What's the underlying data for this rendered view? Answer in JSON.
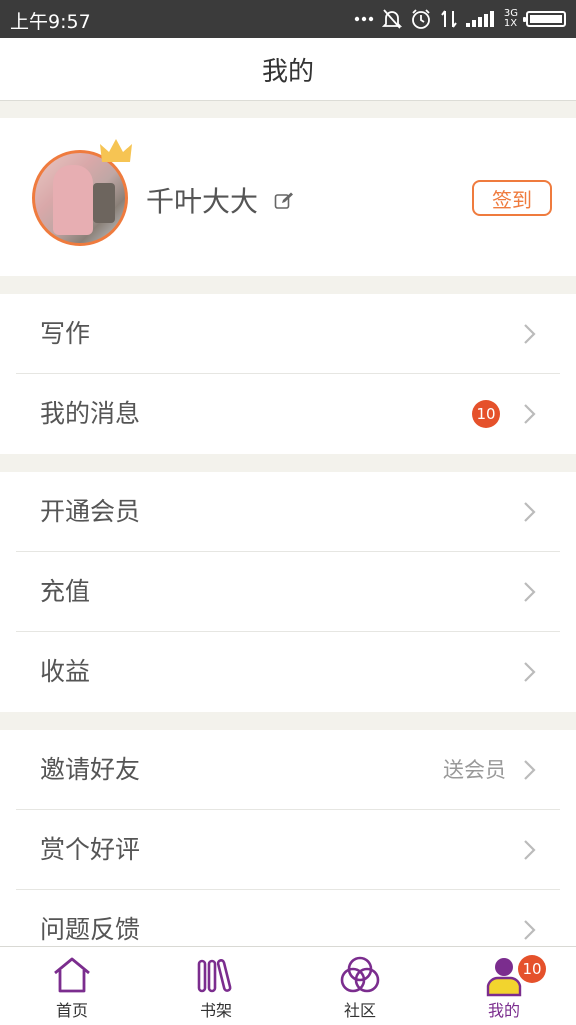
{
  "status_bar": {
    "time": "上午9:57",
    "icons": [
      "more-icon",
      "mute-icon",
      "alarm-icon",
      "transfer-icon",
      "signal-icon",
      "battery-icon"
    ],
    "network_top": "3G",
    "network_bottom": "1X"
  },
  "header": {
    "title": "我的"
  },
  "profile": {
    "username": "千叶大大",
    "signin_label": "签到",
    "accent_color": "#ef7b3e"
  },
  "menu": {
    "group1": [
      {
        "label": "写作"
      },
      {
        "label": "我的消息",
        "badge": "10"
      }
    ],
    "group2": [
      {
        "label": "开通会员"
      },
      {
        "label": "充值"
      },
      {
        "label": "收益"
      }
    ],
    "group3": [
      {
        "label": "邀请好友",
        "extra": "送会员"
      },
      {
        "label": "赏个好评"
      },
      {
        "label": "问题反馈"
      }
    ]
  },
  "bottom_nav": {
    "tabs": [
      {
        "label": "首页",
        "icon": "home-icon"
      },
      {
        "label": "书架",
        "icon": "bookshelf-icon"
      },
      {
        "label": "社区",
        "icon": "community-icon"
      },
      {
        "label": "我的",
        "icon": "profile-icon",
        "badge": "10",
        "active": true
      }
    ],
    "active_color": "#7b2d8e",
    "badge_color": "#e5512b"
  }
}
